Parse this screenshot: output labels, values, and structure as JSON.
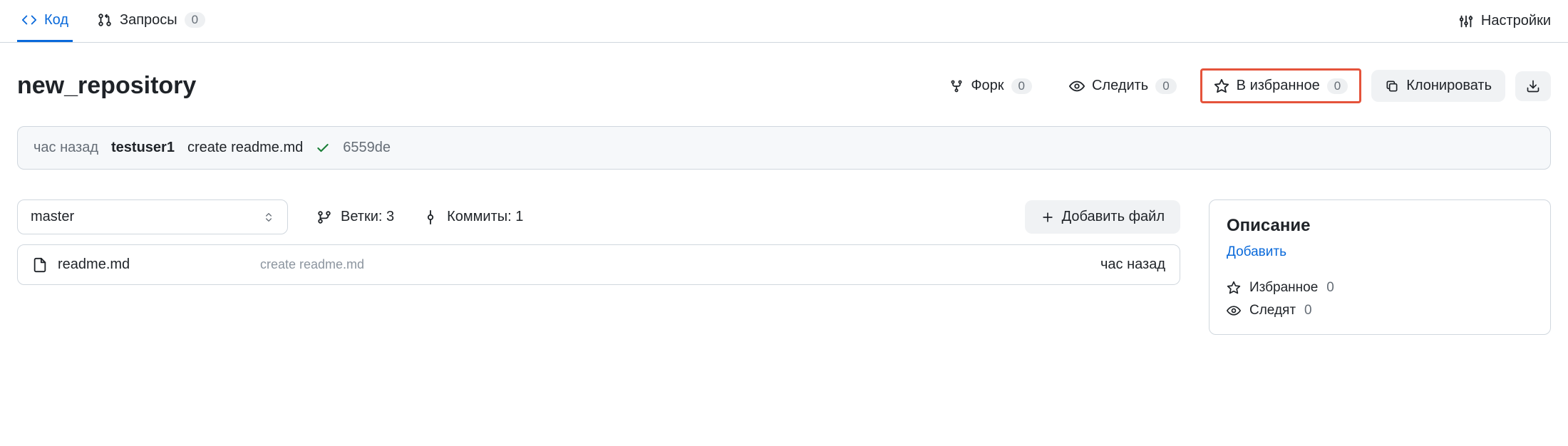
{
  "tabs": {
    "code": "Код",
    "requests": "Запросы",
    "requests_count": "0",
    "settings": "Настройки"
  },
  "repo": {
    "name": "new_repository"
  },
  "actions": {
    "fork": "Форк",
    "fork_count": "0",
    "watch": "Следить",
    "watch_count": "0",
    "star": "В избранное",
    "star_count": "0",
    "clone": "Клонировать"
  },
  "commit": {
    "time": "час назад",
    "author": "testuser1",
    "message": "create readme.md",
    "hash": "6559de"
  },
  "branch": {
    "current": "master",
    "branches_label": "Ветки: 3",
    "commits_label": "Коммиты: 1"
  },
  "add_file": "Добавить файл",
  "files": [
    {
      "name": "readme.md",
      "msg": "create readme.md",
      "time": "час назад"
    }
  ],
  "sidebar": {
    "title": "Описание",
    "add_link": "Добавить",
    "star_label": "Избранное",
    "star_count": "0",
    "watch_label": "Следят",
    "watch_count": "0"
  }
}
